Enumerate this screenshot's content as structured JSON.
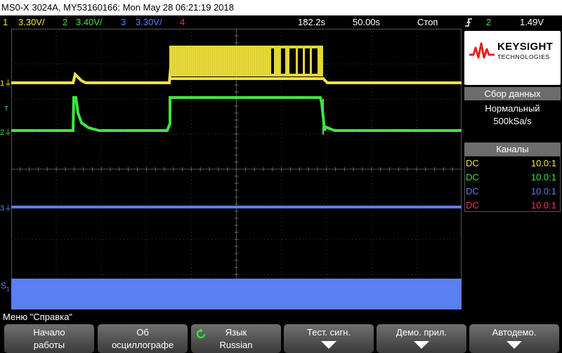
{
  "title": "MS0-X 3024A, MY53160166: Mon May 28 06:21:19 2018",
  "channel_bar": {
    "ch1": {
      "num": "1",
      "scale": "3.30V/",
      "color": "#f5e33a"
    },
    "ch2": {
      "num": "2",
      "scale": "3.40V/",
      "color": "#3ee63c"
    },
    "ch3": {
      "num": "3",
      "scale": "3.30V/",
      "color": "#5a7ff0"
    },
    "ch4": {
      "num": "4",
      "color": "#ff2a6e"
    },
    "timebase": "182.2s",
    "delay": "50.00s",
    "run_state": "Стоп",
    "trigger_source": "2",
    "trigger_level": "1.49V"
  },
  "brand": {
    "name": "KEYSIGHT",
    "sub": "TECHNOLOGIES",
    "accent": "#e2231a"
  },
  "acquisition": {
    "header": "Сбор данных",
    "mode": "Нормальный",
    "rate": "500kSa/s"
  },
  "channels_panel": {
    "header": "Каналы",
    "rows": [
      {
        "coupling": "DC",
        "probe": "10.0:1",
        "color": "#f5e33a"
      },
      {
        "coupling": "DC",
        "probe": "10.0:1",
        "color": "#3ee63c"
      },
      {
        "coupling": "DC",
        "probe": "10.0:1",
        "color": "#5a7ff0"
      },
      {
        "coupling": "DC",
        "probe": "10.0:1",
        "color": "#ff2a6e"
      }
    ]
  },
  "markers": {
    "ch1": "1",
    "ch2": "2",
    "ch3": "3",
    "trig": "T",
    "serial": "S"
  },
  "menu_title": "Меню \"Справка\"",
  "softkeys": [
    {
      "line1": "Начало",
      "line2": "работы"
    },
    {
      "line1": "Об",
      "line2": "осциллографе"
    },
    {
      "line1": "Язык",
      "line2": "Russian"
    },
    {
      "line1": "Тест. сигн."
    },
    {
      "line1": "Демо. прил."
    },
    {
      "line1": "Автодемо."
    }
  ]
}
